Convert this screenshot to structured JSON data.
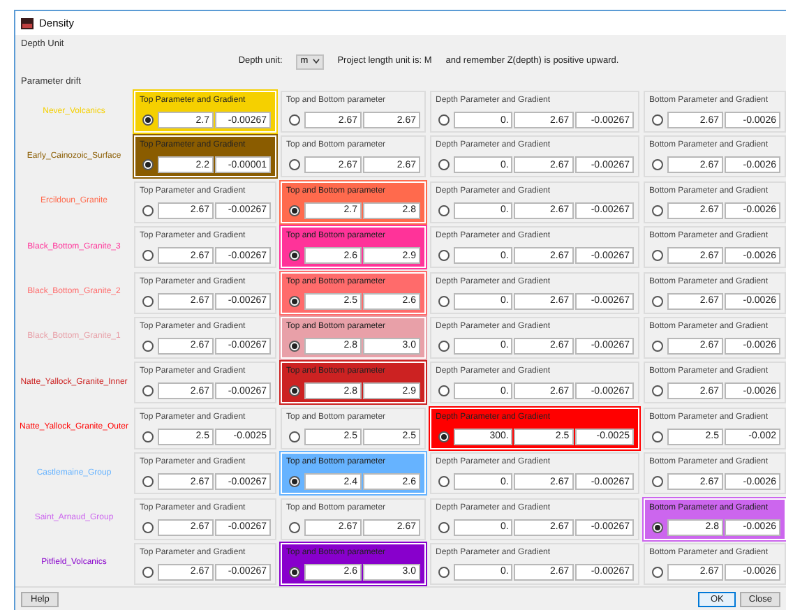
{
  "window": {
    "title": "Density"
  },
  "depth_unit": {
    "section": "Depth Unit",
    "label": "Depth unit:",
    "value": "m",
    "project_unit": "Project length unit is: M",
    "note": "and remember Z(depth) is positive upward."
  },
  "parameter_drift": {
    "section": "Parameter drift",
    "rows": [
      {
        "name": "Never_Volcanics",
        "color": "#f5d000",
        "groups": [
          {
            "title": "Top Parameter and Gradient",
            "selected": true,
            "values": [
              "2.7",
              "-0.00267"
            ]
          },
          {
            "title": "Top and Bottom parameter",
            "selected": false,
            "values": [
              "2.67",
              "2.67"
            ]
          },
          {
            "title": "Depth Parameter and Gradient",
            "selected": false,
            "values": [
              "0.",
              "2.67",
              "-0.00267"
            ]
          },
          {
            "title": "Bottom Parameter and Gradient",
            "selected": false,
            "values": [
              "2.67",
              "-0.0026"
            ]
          }
        ]
      },
      {
        "name": "Early_Cainozoic_Surface",
        "color": "#8a5c00",
        "groups": [
          {
            "title": "Top Parameter and Gradient",
            "selected": true,
            "values": [
              "2.2",
              "-0.00001"
            ]
          },
          {
            "title": "Top and Bottom parameter",
            "selected": false,
            "values": [
              "2.67",
              "2.67"
            ]
          },
          {
            "title": "Depth Parameter and Gradient",
            "selected": false,
            "values": [
              "0.",
              "2.67",
              "-0.00267"
            ]
          },
          {
            "title": "Bottom Parameter and Gradient",
            "selected": false,
            "values": [
              "2.67",
              "-0.0026"
            ]
          }
        ]
      },
      {
        "name": "Ercildoun_Granite",
        "color": "#ff6a4d",
        "groups": [
          {
            "title": "Top Parameter and Gradient",
            "selected": false,
            "values": [
              "2.67",
              "-0.00267"
            ]
          },
          {
            "title": "Top and Bottom parameter",
            "selected": true,
            "values": [
              "2.7",
              "2.8"
            ]
          },
          {
            "title": "Depth Parameter and Gradient",
            "selected": false,
            "values": [
              "0.",
              "2.67",
              "-0.00267"
            ]
          },
          {
            "title": "Bottom Parameter and Gradient",
            "selected": false,
            "values": [
              "2.67",
              "-0.0026"
            ]
          }
        ]
      },
      {
        "name": "Black_Bottom_Granite_3",
        "color": "#ff3399",
        "groups": [
          {
            "title": "Top Parameter and Gradient",
            "selected": false,
            "values": [
              "2.67",
              "-0.00267"
            ]
          },
          {
            "title": "Top and Bottom parameter",
            "selected": true,
            "values": [
              "2.6",
              "2.9"
            ]
          },
          {
            "title": "Depth Parameter and Gradient",
            "selected": false,
            "values": [
              "0.",
              "2.67",
              "-0.00267"
            ]
          },
          {
            "title": "Bottom Parameter and Gradient",
            "selected": false,
            "values": [
              "2.67",
              "-0.0026"
            ]
          }
        ]
      },
      {
        "name": "Black_Bottom_Granite_2",
        "color": "#ff6b6b",
        "groups": [
          {
            "title": "Top Parameter and Gradient",
            "selected": false,
            "values": [
              "2.67",
              "-0.00267"
            ]
          },
          {
            "title": "Top and Bottom parameter",
            "selected": true,
            "values": [
              "2.5",
              "2.6"
            ]
          },
          {
            "title": "Depth Parameter and Gradient",
            "selected": false,
            "values": [
              "0.",
              "2.67",
              "-0.00267"
            ]
          },
          {
            "title": "Bottom Parameter and Gradient",
            "selected": false,
            "values": [
              "2.67",
              "-0.0026"
            ]
          }
        ]
      },
      {
        "name": "Black_Bottom_Granite_1",
        "color": "#e8a0a8",
        "groups": [
          {
            "title": "Top Parameter and Gradient",
            "selected": false,
            "values": [
              "2.67",
              "-0.00267"
            ]
          },
          {
            "title": "Top and Bottom parameter",
            "selected": true,
            "values": [
              "2.8",
              "3.0"
            ]
          },
          {
            "title": "Depth Parameter and Gradient",
            "selected": false,
            "values": [
              "0.",
              "2.67",
              "-0.00267"
            ]
          },
          {
            "title": "Bottom Parameter and Gradient",
            "selected": false,
            "values": [
              "2.67",
              "-0.0026"
            ]
          }
        ]
      },
      {
        "name": "Natte_Yallock_Granite_Inner",
        "color": "#cc2222",
        "groups": [
          {
            "title": "Top Parameter and Gradient",
            "selected": false,
            "values": [
              "2.67",
              "-0.00267"
            ]
          },
          {
            "title": "Top and Bottom parameter",
            "selected": true,
            "values": [
              "2.8",
              "2.9"
            ]
          },
          {
            "title": "Depth Parameter and Gradient",
            "selected": false,
            "values": [
              "0.",
              "2.67",
              "-0.00267"
            ]
          },
          {
            "title": "Bottom Parameter and Gradient",
            "selected": false,
            "values": [
              "2.67",
              "-0.0026"
            ]
          }
        ]
      },
      {
        "name": "Natte_Yallock_Granite_Outer",
        "color": "#ff0000",
        "groups": [
          {
            "title": "Top Parameter and Gradient",
            "selected": false,
            "values": [
              "2.5",
              "-0.0025"
            ]
          },
          {
            "title": "Top and Bottom parameter",
            "selected": false,
            "values": [
              "2.5",
              "2.5"
            ]
          },
          {
            "title": "Depth Parameter and Gradient",
            "selected": true,
            "values": [
              "300.",
              "2.5",
              "-0.0025"
            ]
          },
          {
            "title": "Bottom Parameter and Gradient",
            "selected": false,
            "values": [
              "2.5",
              "-0.002"
            ]
          }
        ]
      },
      {
        "name": "Castlemaine_Group",
        "color": "#66b3ff",
        "groups": [
          {
            "title": "Top Parameter and Gradient",
            "selected": false,
            "values": [
              "2.67",
              "-0.00267"
            ]
          },
          {
            "title": "Top and Bottom parameter",
            "selected": true,
            "values": [
              "2.4",
              "2.6"
            ]
          },
          {
            "title": "Depth Parameter and Gradient",
            "selected": false,
            "values": [
              "0.",
              "2.67",
              "-0.00267"
            ]
          },
          {
            "title": "Bottom Parameter and Gradient",
            "selected": false,
            "values": [
              "2.67",
              "-0.0026"
            ]
          }
        ]
      },
      {
        "name": "Saint_Arnaud_Group",
        "color": "#cc66ee",
        "groups": [
          {
            "title": "Top Parameter and Gradient",
            "selected": false,
            "values": [
              "2.67",
              "-0.00267"
            ]
          },
          {
            "title": "Top and Bottom parameter",
            "selected": false,
            "values": [
              "2.67",
              "2.67"
            ]
          },
          {
            "title": "Depth Parameter and Gradient",
            "selected": false,
            "values": [
              "0.",
              "2.67",
              "-0.00267"
            ]
          },
          {
            "title": "Bottom Parameter and Gradient",
            "selected": true,
            "values": [
              "2.8",
              "-0.0026"
            ]
          }
        ]
      },
      {
        "name": "Pitfield_Volcanics",
        "color": "#8800cc",
        "groups": [
          {
            "title": "Top Parameter and Gradient",
            "selected": false,
            "values": [
              "2.67",
              "-0.00267"
            ]
          },
          {
            "title": "Top and Bottom parameter",
            "selected": true,
            "values": [
              "2.6",
              "3.0"
            ]
          },
          {
            "title": "Depth Parameter and Gradient",
            "selected": false,
            "values": [
              "0.",
              "2.67",
              "-0.00267"
            ]
          },
          {
            "title": "Bottom Parameter and Gradient",
            "selected": false,
            "values": [
              "2.67",
              "-0.0026"
            ]
          }
        ]
      }
    ]
  },
  "buttons": {
    "help": "Help",
    "ok": "OK",
    "close": "Close"
  }
}
